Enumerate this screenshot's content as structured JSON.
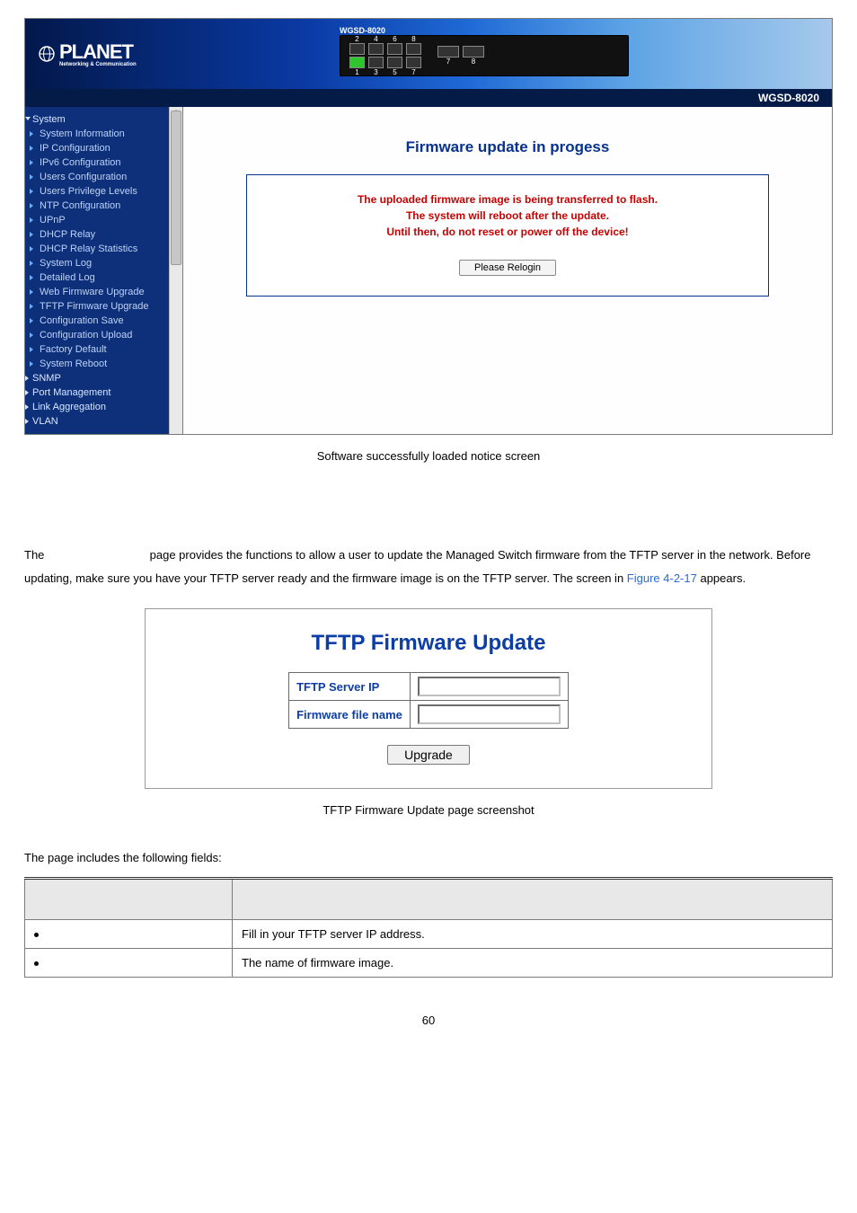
{
  "screenshot1": {
    "logo_main": "PLANET",
    "logo_sub": "Networking & Communication",
    "switch_model": "WGSD-8020",
    "port_top": [
      "2",
      "4",
      "6",
      "8"
    ],
    "port_bottom": [
      "1",
      "3",
      "5",
      "7"
    ],
    "sfp_nums": [
      "7",
      "8"
    ],
    "model_bar": "WGSD-8020",
    "sidebar": {
      "top_items": [
        "System"
      ],
      "items": [
        "System Information",
        "IP Configuration",
        "IPv6 Configuration",
        "Users Configuration",
        "Users Privilege Levels",
        "NTP Configuration",
        "UPnP",
        "DHCP Relay",
        "DHCP Relay Statistics",
        "System Log",
        "Detailed Log",
        "Web Firmware Upgrade",
        "TFTP Firmware Upgrade",
        "Configuration Save",
        "Configuration Upload",
        "Factory Default",
        "System Reboot"
      ],
      "bottom_items": [
        "SNMP",
        "Port Management",
        "Link Aggregation",
        "VLAN"
      ]
    },
    "main": {
      "title": "Firmware update in progess",
      "warn_l1": "The uploaded firmware image is being transferred to flash.",
      "warn_l2": "The system will reboot after the update.",
      "warn_l3": "Until then, do not reset or power off the device!",
      "button": "Please Relogin"
    }
  },
  "caption1": "Software successfully loaded notice screen",
  "para": {
    "p1a": "The ",
    "p1b": " page provides the functions to allow a user to update the Managed Switch firmware from the TFTP server in the network. Before updating, make sure you have your TFTP server ready and the firmware image is on the TFTP server. The screen in ",
    "figref": "Figure 4-2-17",
    "p1c": " appears."
  },
  "tftp": {
    "title": "TFTP Firmware Update",
    "row1": "TFTP Server IP",
    "row2": "Firmware file name",
    "button": "Upgrade"
  },
  "caption2": "TFTP Firmware Update page screenshot",
  "fields_intro": "The page includes the following fields:",
  "fields_table": {
    "h1": "",
    "h2": "",
    "r1_desc": "Fill in your TFTP server IP address.",
    "r2_desc": "The name of firmware image."
  },
  "page_number": "60"
}
